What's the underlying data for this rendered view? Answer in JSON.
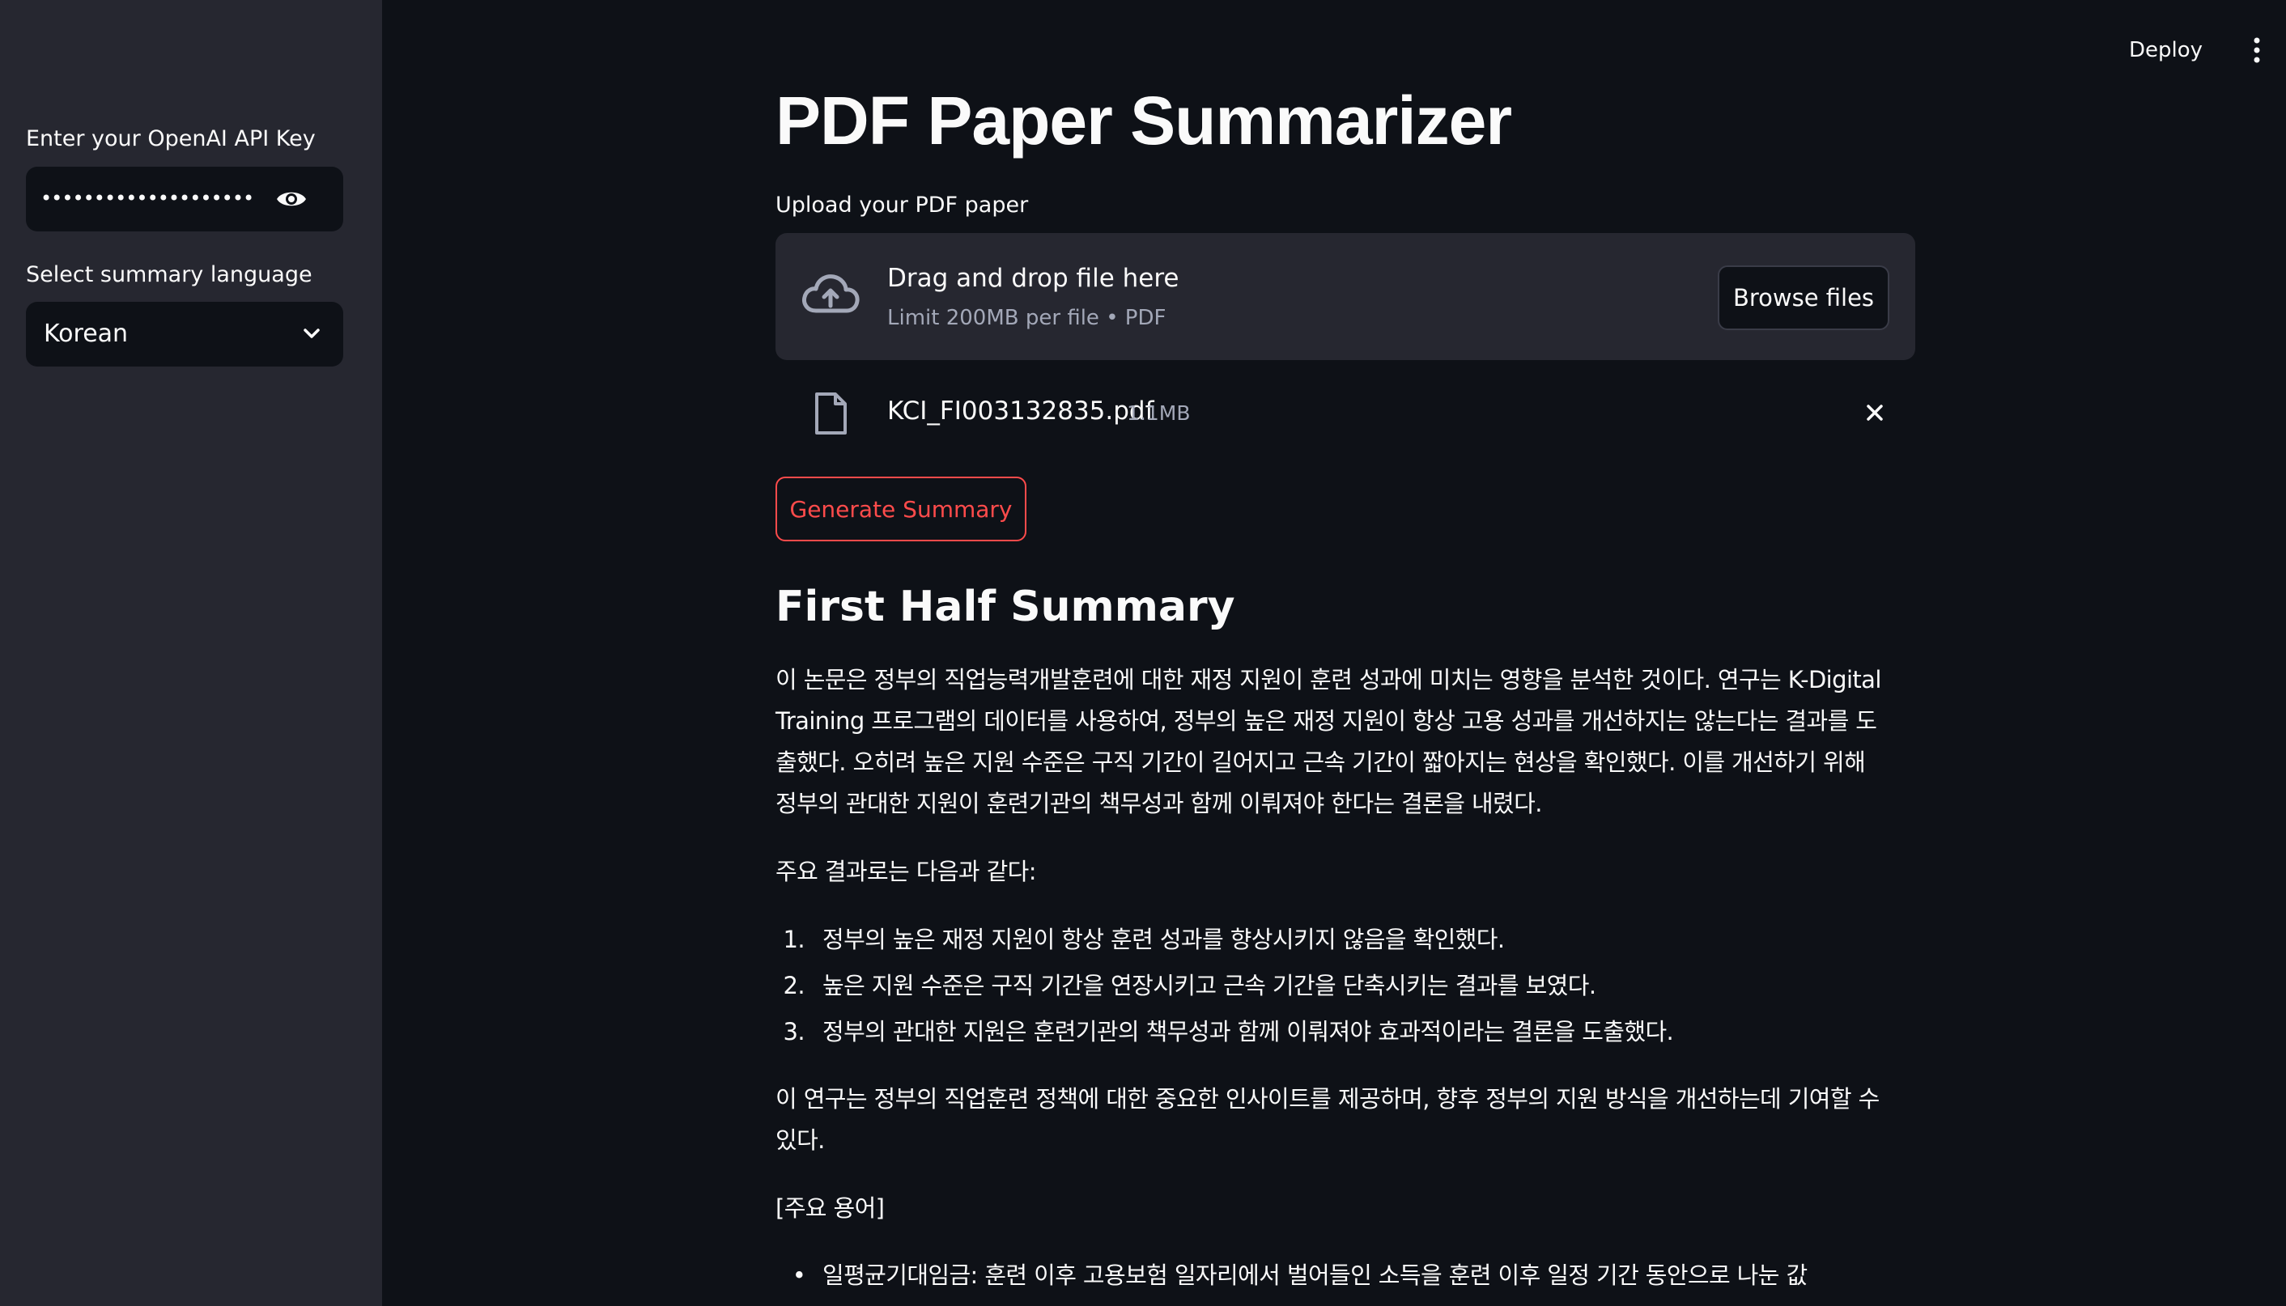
{
  "sidebar": {
    "api_key_label": "Enter your OpenAI API Key",
    "api_key_value": "••••••••••••••••••••••••••••",
    "language_label": "Select summary language",
    "language_value": "Korean"
  },
  "header": {
    "deploy_label": "Deploy"
  },
  "main": {
    "title": "PDF Paper Summarizer",
    "upload_label": "Upload your PDF paper",
    "dropzone": {
      "title": "Drag and drop file here",
      "limit": "Limit 200MB per file • PDF",
      "browse_label": "Browse files"
    },
    "file": {
      "name": "KCI_FI003132835.pdf",
      "size": "1.1MB"
    },
    "generate_label": "Generate Summary",
    "summary_title": "First Half Summary",
    "para1_lines": [
      "이 논문은 정부의 직업능력개발훈련에 대한 재정 지원이 훈련 성과에 미치는 영향을 분석한 것이다. 연구는 K-Digital",
      "Training 프로그램의 데이터를 사용하여, 정부의 높은 재정 지원이 항상 고용 성과를 개선하지는 않는다는 결과를 도",
      "출했다. 오히려 높은 지원 수준은 구직 기간이 길어지고 근속 기간이 짧아지는 현상을 확인했다. 이를 개선하기 위해",
      "정부의 관대한 지원이 훈련기관의 책무성과 함께 이뤄져야 한다는 결론을 내렸다."
    ],
    "para2": "주요 결과로는 다음과 같다:",
    "ordered_list": [
      {
        "num": "1.",
        "text": "정부의 높은 재정 지원이 항상 훈련 성과를 향상시키지 않음을 확인했다."
      },
      {
        "num": "2.",
        "text": "높은 지원 수준은 구직 기간을 연장시키고 근속 기간을 단축시키는 결과를 보였다."
      },
      {
        "num": "3.",
        "text": "정부의 관대한 지원은 훈련기관의 책무성과 함께 이뤄져야 효과적이라는 결론을 도출했다."
      }
    ],
    "para3_lines": [
      "이 연구는 정부의 직업훈련 정책에 대한 중요한 인사이트를 제공하며, 향후 정부의 지원 방식을 개선하는데 기여할 수",
      "있다."
    ],
    "para4": "[주요 용어]",
    "bullet_list": [
      {
        "bullet": "•",
        "text": "일평균기대임금: 훈련 이후 고용보험 일자리에서 벌어들인 소득을 훈련 이후 일정 기간 동안으로 나눈 값"
      }
    ]
  },
  "colors": {
    "background": "#0e1117",
    "sidebar": "#262730",
    "accent": "#ff4b4b",
    "muted_text": "#a3a8b8"
  },
  "icons": {
    "eye": "eye-icon",
    "chevron": "chevron-down-icon",
    "kebab": "kebab-menu-icon",
    "cloud": "cloud-upload-icon",
    "file": "file-icon",
    "close": "close-icon"
  }
}
